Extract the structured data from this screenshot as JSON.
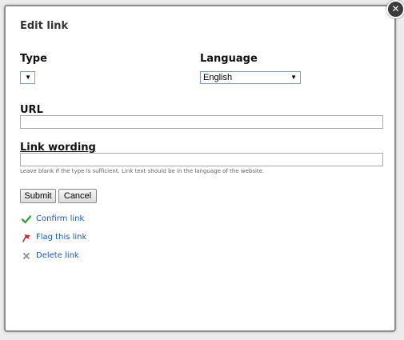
{
  "dialog": {
    "title": "Edit link",
    "close_glyph": "✕"
  },
  "type_field": {
    "label": "Type",
    "selected": "",
    "arrow": "▼"
  },
  "language_field": {
    "label": "Language",
    "selected": "English",
    "arrow": "▼"
  },
  "url_field": {
    "label": "URL",
    "value": ""
  },
  "link_wording_field": {
    "label": "Link wording",
    "value": "",
    "hint": "Leave blank if the type is sufficient. Link text should be in the language of the website."
  },
  "buttons": {
    "submit": "Submit",
    "cancel": "Cancel"
  },
  "actions": {
    "confirm": {
      "label": "Confirm link",
      "icon": "check-icon",
      "color": "#3aa23a"
    },
    "flag": {
      "label": "Flag this link",
      "icon": "flag-icon",
      "color": "#d0302d"
    },
    "delete": {
      "label": "Delete link",
      "icon": "x-icon",
      "color": "#8a8a8a"
    }
  }
}
